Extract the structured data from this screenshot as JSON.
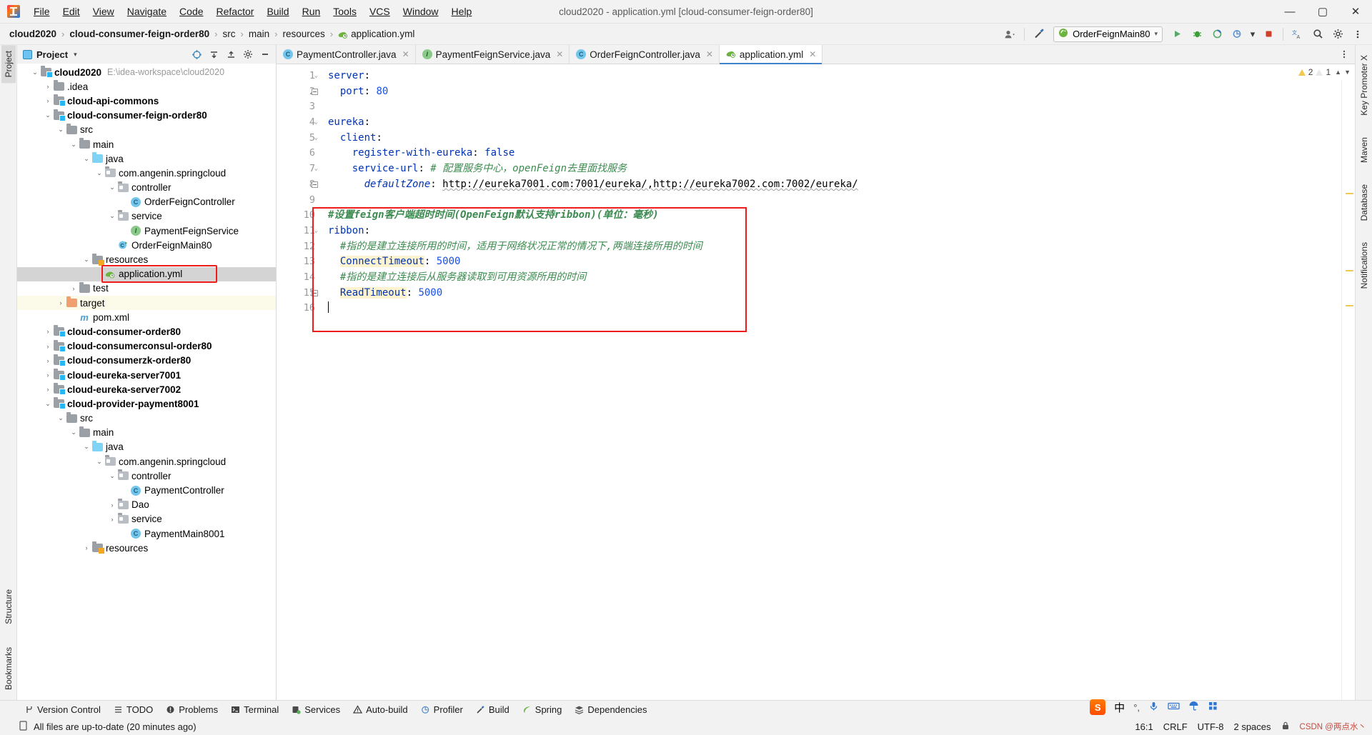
{
  "window": {
    "title": "cloud2020 - application.yml [cloud-consumer-feign-order80]",
    "minimize": "—",
    "maximize": "▢",
    "close": "✕"
  },
  "menu": [
    {
      "label": "File"
    },
    {
      "label": "Edit"
    },
    {
      "label": "View"
    },
    {
      "label": "Navigate"
    },
    {
      "label": "Code"
    },
    {
      "label": "Refactor"
    },
    {
      "label": "Build"
    },
    {
      "label": "Run"
    },
    {
      "label": "Tools"
    },
    {
      "label": "VCS"
    },
    {
      "label": "Window"
    },
    {
      "label": "Help"
    }
  ],
  "breadcrumb": {
    "items": [
      "cloud2020",
      "cloud-consumer-feign-order80",
      "src",
      "main",
      "resources",
      "application.yml"
    ],
    "separator": "›"
  },
  "navbar_right": {
    "run_config": "OrderFeignMain80",
    "run_config_caret": "▾",
    "user_icon": "user-avatar-icon",
    "hammer_icon": "build-icon",
    "run_icon": "▶",
    "debug_icon": "debug-icon",
    "coverage_icon": "coverage-icon",
    "profiler_caret": "▾",
    "stop_icon": "stop-icon",
    "translate_icon": "translate-icon",
    "search_icon": "search-icon",
    "settings_icon": "gear-icon",
    "more_icon": "more-icon"
  },
  "left_strip": {
    "project_tab": "Project",
    "bookmarks_tab": "Bookmarks",
    "structure_tab": "Structure"
  },
  "right_strip": {
    "key_promoter": "Key Promoter X",
    "maven": "Maven",
    "database": "Database",
    "notifications": "Notifications"
  },
  "project_panel": {
    "title": "Project",
    "caret": "▾",
    "icons": [
      "target-icon",
      "collapse-icon",
      "expand-icon",
      "gear-icon",
      "hide-icon"
    ],
    "tree": [
      {
        "depth": 0,
        "arrow": "v",
        "icon": "module",
        "label": "cloud2020",
        "bold": true,
        "note": "E:\\idea-workspace\\cloud2020"
      },
      {
        "depth": 1,
        "arrow": ">",
        "icon": "folder",
        "label": ".idea",
        "bold": false,
        "note": ""
      },
      {
        "depth": 1,
        "arrow": ">",
        "icon": "module",
        "label": "cloud-api-commons",
        "bold": true,
        "note": ""
      },
      {
        "depth": 1,
        "arrow": "v",
        "icon": "module",
        "label": "cloud-consumer-feign-order80",
        "bold": true,
        "note": ""
      },
      {
        "depth": 2,
        "arrow": "v",
        "icon": "folder",
        "label": "src",
        "bold": false,
        "note": ""
      },
      {
        "depth": 3,
        "arrow": "v",
        "icon": "folder",
        "label": "main",
        "bold": false,
        "note": ""
      },
      {
        "depth": 4,
        "arrow": "v",
        "icon": "folder-blue",
        "label": "java",
        "bold": false,
        "note": ""
      },
      {
        "depth": 5,
        "arrow": "v",
        "icon": "package",
        "label": "com.angenin.springcloud",
        "bold": false,
        "note": ""
      },
      {
        "depth": 6,
        "arrow": "v",
        "icon": "package",
        "label": "controller",
        "bold": false,
        "note": ""
      },
      {
        "depth": 7,
        "arrow": "",
        "icon": "class",
        "label": "OrderFeignController",
        "bold": false,
        "note": ""
      },
      {
        "depth": 6,
        "arrow": "v",
        "icon": "package",
        "label": "service",
        "bold": false,
        "note": ""
      },
      {
        "depth": 7,
        "arrow": "",
        "icon": "interface",
        "label": "PaymentFeignService",
        "bold": false,
        "note": ""
      },
      {
        "depth": 6,
        "arrow": "",
        "icon": "spring-class",
        "label": "OrderFeignMain80",
        "bold": false,
        "note": ""
      },
      {
        "depth": 4,
        "arrow": "v",
        "icon": "folder-res",
        "label": "resources",
        "bold": false,
        "note": ""
      },
      {
        "depth": 5,
        "arrow": "",
        "icon": "yaml",
        "label": "application.yml",
        "bold": false,
        "note": "",
        "selected": true,
        "boxed": true
      },
      {
        "depth": 3,
        "arrow": ">",
        "icon": "folder",
        "label": "test",
        "bold": false,
        "note": ""
      },
      {
        "depth": 2,
        "arrow": ">",
        "icon": "folder-orange",
        "label": "target",
        "bold": false,
        "note": "",
        "highlight": true
      },
      {
        "depth": 3,
        "arrow": "",
        "icon": "maven",
        "label": "pom.xml",
        "bold": false,
        "note": ""
      },
      {
        "depth": 1,
        "arrow": ">",
        "icon": "module",
        "label": "cloud-consumer-order80",
        "bold": true,
        "note": ""
      },
      {
        "depth": 1,
        "arrow": ">",
        "icon": "module",
        "label": "cloud-consumerconsul-order80",
        "bold": true,
        "note": ""
      },
      {
        "depth": 1,
        "arrow": ">",
        "icon": "module",
        "label": "cloud-consumerzk-order80",
        "bold": true,
        "note": ""
      },
      {
        "depth": 1,
        "arrow": ">",
        "icon": "module",
        "label": "cloud-eureka-server7001",
        "bold": true,
        "note": ""
      },
      {
        "depth": 1,
        "arrow": ">",
        "icon": "module",
        "label": "cloud-eureka-server7002",
        "bold": true,
        "note": ""
      },
      {
        "depth": 1,
        "arrow": "v",
        "icon": "module",
        "label": "cloud-provider-payment8001",
        "bold": true,
        "note": ""
      },
      {
        "depth": 2,
        "arrow": "v",
        "icon": "folder",
        "label": "src",
        "bold": false,
        "note": ""
      },
      {
        "depth": 3,
        "arrow": "v",
        "icon": "folder",
        "label": "main",
        "bold": false,
        "note": ""
      },
      {
        "depth": 4,
        "arrow": "v",
        "icon": "folder-blue",
        "label": "java",
        "bold": false,
        "note": ""
      },
      {
        "depth": 5,
        "arrow": "v",
        "icon": "package",
        "label": "com.angenin.springcloud",
        "bold": false,
        "note": ""
      },
      {
        "depth": 6,
        "arrow": "v",
        "icon": "package",
        "label": "controller",
        "bold": false,
        "note": ""
      },
      {
        "depth": 7,
        "arrow": "",
        "icon": "class",
        "label": "PaymentController",
        "bold": false,
        "note": ""
      },
      {
        "depth": 6,
        "arrow": ">",
        "icon": "package",
        "label": "Dao",
        "bold": false,
        "note": ""
      },
      {
        "depth": 6,
        "arrow": ">",
        "icon": "package",
        "label": "service",
        "bold": false,
        "note": ""
      },
      {
        "depth": 7,
        "arrow": "",
        "icon": "class",
        "label": "PaymentMain8001",
        "bold": false,
        "note": ""
      },
      {
        "depth": 4,
        "arrow": ">",
        "icon": "folder-res",
        "label": "resources",
        "bold": false,
        "note": ""
      }
    ]
  },
  "editor": {
    "tabs": [
      {
        "label": "PaymentController.java",
        "icon": "class",
        "active": false,
        "close": "✕"
      },
      {
        "label": "PaymentFeignService.java",
        "icon": "interface",
        "active": false,
        "close": "✕"
      },
      {
        "label": "OrderFeignController.java",
        "icon": "class",
        "active": false,
        "close": "✕"
      },
      {
        "label": "application.yml",
        "icon": "yaml",
        "active": true,
        "close": "✕"
      }
    ],
    "tabs_more_icon": "more-vertical-icon",
    "inspection": {
      "warning_count": "2",
      "weak_warning_count": "1",
      "up_icon": "▲",
      "down_icon": "▼"
    },
    "line_numbers": [
      "1",
      "2",
      "3",
      "4",
      "5",
      "6",
      "7",
      "8",
      "9",
      "10",
      "11",
      "12",
      "13",
      "14",
      "15",
      "16"
    ],
    "lines": [
      {
        "n": 1,
        "segments": [
          {
            "t": "server",
            "c": "key"
          },
          {
            "t": ":",
            "c": "plain"
          }
        ]
      },
      {
        "n": 2,
        "segments": [
          {
            "t": "  port",
            "c": "key"
          },
          {
            "t": ": ",
            "c": "plain"
          },
          {
            "t": "80",
            "c": "num"
          }
        ]
      },
      {
        "n": 3,
        "segments": []
      },
      {
        "n": 4,
        "segments": [
          {
            "t": "eureka",
            "c": "key"
          },
          {
            "t": ":",
            "c": "plain"
          }
        ]
      },
      {
        "n": 5,
        "segments": [
          {
            "t": "  client",
            "c": "key"
          },
          {
            "t": ":",
            "c": "plain"
          }
        ]
      },
      {
        "n": 6,
        "segments": [
          {
            "t": "    register-with-eureka",
            "c": "key"
          },
          {
            "t": ": ",
            "c": "plain"
          },
          {
            "t": "false",
            "c": "val"
          }
        ]
      },
      {
        "n": 7,
        "segments": [
          {
            "t": "    service-url",
            "c": "key"
          },
          {
            "t": ": ",
            "c": "plain"
          },
          {
            "t": "# 配置服务中心，openFeign去里面找服务",
            "c": "cmt"
          }
        ]
      },
      {
        "n": 8,
        "segments": [
          {
            "t": "      defaultZone",
            "c": "anchor"
          },
          {
            "t": ": ",
            "c": "plain"
          },
          {
            "t": "http://eureka7001.com:7001/eureka/,http://eureka7002.com:7002/eureka/",
            "c": "str"
          }
        ]
      },
      {
        "n": 9,
        "segments": []
      },
      {
        "n": 10,
        "segments": [
          {
            "t": "#设置feign客户端超时时间(OpenFeign默认支持ribbon)(单位：毫秒)",
            "c": "cmtb"
          }
        ]
      },
      {
        "n": 11,
        "segments": [
          {
            "t": "ribbon",
            "c": "key"
          },
          {
            "t": ":",
            "c": "plain"
          }
        ]
      },
      {
        "n": 12,
        "segments": [
          {
            "t": "  #指的是建立连接所用的时间，适用于网络状况正常的情况下,两端连接所用的时间",
            "c": "cmt"
          }
        ]
      },
      {
        "n": 13,
        "segments": [
          {
            "t": "  ",
            "c": "plain"
          },
          {
            "t": "ConnectTimeout",
            "c": "keyhl"
          },
          {
            "t": ": ",
            "c": "plain"
          },
          {
            "t": "5000",
            "c": "num"
          }
        ]
      },
      {
        "n": 14,
        "segments": [
          {
            "t": "  #指的是建立连接后从服务器读取到可用资源所用的时间",
            "c": "cmt"
          }
        ]
      },
      {
        "n": 15,
        "segments": [
          {
            "t": "  ",
            "c": "plain"
          },
          {
            "t": "ReadTimeout",
            "c": "keyhl"
          },
          {
            "t": ": ",
            "c": "plain"
          },
          {
            "t": "5000",
            "c": "num"
          }
        ]
      },
      {
        "n": 16,
        "segments": [
          {
            "t": "",
            "c": "caret"
          }
        ]
      }
    ]
  },
  "bottom_tools": [
    {
      "label": "Version Control",
      "icon": "branch-icon"
    },
    {
      "label": "TODO",
      "icon": "list-icon"
    },
    {
      "label": "Problems",
      "icon": "error-icon"
    },
    {
      "label": "Terminal",
      "icon": "terminal-icon"
    },
    {
      "label": "Services",
      "icon": "services-icon"
    },
    {
      "label": "Auto-build",
      "icon": "warning-icon"
    },
    {
      "label": "Profiler",
      "icon": "profiler-icon"
    },
    {
      "label": "Build",
      "icon": "hammer-icon"
    },
    {
      "label": "Spring",
      "icon": "spring-leaf-icon"
    },
    {
      "label": "Dependencies",
      "icon": "layers-icon"
    }
  ],
  "statusbar": {
    "message": "All files are up-to-date (20 minutes ago)",
    "message_icon": "document-icon",
    "caret_position": "16:1",
    "line_separator": "CRLF",
    "encoding": "UTF-8",
    "indent": "2 spaces",
    "lock_icon": "lock-icon",
    "ime": {
      "logo": "S",
      "mode": "中",
      "punct": "°,",
      "mic": "mic-icon",
      "keyboard": "keyboard-icon",
      "umbrella": "umbrella-icon",
      "grid": "grid-icon"
    },
    "watermark": "CSDN @两点水丶"
  }
}
